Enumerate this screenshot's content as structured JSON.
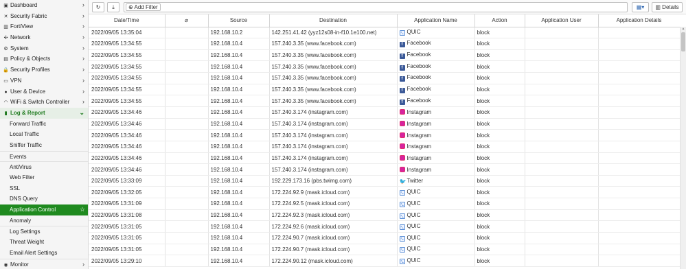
{
  "sidebar": {
    "items": [
      {
        "label": "Dashboard",
        "icon": "dashboard-icon",
        "glyph": "▣",
        "has_chevron": true
      },
      {
        "label": "Security Fabric",
        "icon": "security-fabric-icon",
        "glyph": "✕",
        "has_chevron": true
      },
      {
        "label": "FortiView",
        "icon": "fortiview-icon",
        "glyph": "▥",
        "has_chevron": true
      },
      {
        "label": "Network",
        "icon": "network-icon",
        "glyph": "✣",
        "has_chevron": true
      },
      {
        "label": "System",
        "icon": "gear-icon",
        "glyph": "⚙",
        "has_chevron": true
      },
      {
        "label": "Policy & Objects",
        "icon": "policy-icon",
        "glyph": "▤",
        "has_chevron": true
      },
      {
        "label": "Security Profiles",
        "icon": "lock-icon",
        "glyph": "🔒",
        "has_chevron": true
      },
      {
        "label": "VPN",
        "icon": "vpn-icon",
        "glyph": "▭",
        "has_chevron": true
      },
      {
        "label": "User & Device",
        "icon": "user-icon",
        "glyph": "●",
        "has_chevron": true
      },
      {
        "label": "WiFi & Switch Controller",
        "icon": "wifi-icon",
        "glyph": "◠",
        "has_chevron": true
      }
    ],
    "open_section": {
      "label": "Log & Report",
      "icon": "log-report-icon",
      "glyph": "▮"
    },
    "sub_items": [
      {
        "label": "Forward Traffic",
        "group_top": false,
        "active": false
      },
      {
        "label": "Local Traffic",
        "group_top": false,
        "active": false
      },
      {
        "label": "Sniffer Traffic",
        "group_top": false,
        "active": false
      },
      {
        "label": "Events",
        "group_top": true,
        "active": false
      },
      {
        "label": "AntiVirus",
        "group_top": true,
        "active": false
      },
      {
        "label": "Web Filter",
        "group_top": false,
        "active": false
      },
      {
        "label": "SSL",
        "group_top": false,
        "active": false
      },
      {
        "label": "DNS Query",
        "group_top": false,
        "active": false
      },
      {
        "label": "Application Control",
        "group_top": false,
        "active": true
      },
      {
        "label": "Anomaly",
        "group_top": false,
        "active": false
      },
      {
        "label": "Log Settings",
        "group_top": true,
        "active": false
      },
      {
        "label": "Threat Weight",
        "group_top": false,
        "active": false
      },
      {
        "label": "Email Alert Settings",
        "group_top": false,
        "active": false
      }
    ],
    "bottom_item": {
      "label": "Monitor",
      "icon": "monitor-icon",
      "glyph": "◉"
    }
  },
  "toolbar": {
    "refresh_glyph": "↻",
    "download_glyph": "⤓",
    "add_filter_label": "Add Filter",
    "add_filter_glyph": "⊕",
    "view_glyph": "▦▾",
    "details_label": "Details",
    "details_glyph": "▥"
  },
  "table": {
    "columns": [
      "Date/Time",
      "",
      "Source",
      "Destination",
      "Application Name",
      "Action",
      "Application User",
      "Application Details"
    ],
    "attachment_glyph": "⌀",
    "rows": [
      [
        "2022/09/05 13:35:04",
        "",
        "192.168.10.2",
        "142.251.41.42 (yyz12s08-in-f10.1e100.net)",
        "QUIC",
        "block",
        "",
        ""
      ],
      [
        "2022/09/05 13:34:55",
        "",
        "192.168.10.4",
        "157.240.3.35 (www.facebook.com)",
        "Facebook",
        "block",
        "",
        ""
      ],
      [
        "2022/09/05 13:34:55",
        "",
        "192.168.10.4",
        "157.240.3.35 (www.facebook.com)",
        "Facebook",
        "block",
        "",
        ""
      ],
      [
        "2022/09/05 13:34:55",
        "",
        "192.168.10.4",
        "157.240.3.35 (www.facebook.com)",
        "Facebook",
        "block",
        "",
        ""
      ],
      [
        "2022/09/05 13:34:55",
        "",
        "192.168.10.4",
        "157.240.3.35 (www.facebook.com)",
        "Facebook",
        "block",
        "",
        ""
      ],
      [
        "2022/09/05 13:34:55",
        "",
        "192.168.10.4",
        "157.240.3.35 (www.facebook.com)",
        "Facebook",
        "block",
        "",
        ""
      ],
      [
        "2022/09/05 13:34:55",
        "",
        "192.168.10.4",
        "157.240.3.35 (www.facebook.com)",
        "Facebook",
        "block",
        "",
        ""
      ],
      [
        "2022/09/05 13:34:46",
        "",
        "192.168.10.4",
        "157.240.3.174 (instagram.com)",
        "Instagram",
        "block",
        "",
        ""
      ],
      [
        "2022/09/05 13:34:46",
        "",
        "192.168.10.4",
        "157.240.3.174 (instagram.com)",
        "Instagram",
        "block",
        "",
        ""
      ],
      [
        "2022/09/05 13:34:46",
        "",
        "192.168.10.4",
        "157.240.3.174 (instagram.com)",
        "Instagram",
        "block",
        "",
        ""
      ],
      [
        "2022/09/05 13:34:46",
        "",
        "192.168.10.4",
        "157.240.3.174 (instagram.com)",
        "Instagram",
        "block",
        "",
        ""
      ],
      [
        "2022/09/05 13:34:46",
        "",
        "192.168.10.4",
        "157.240.3.174 (instagram.com)",
        "Instagram",
        "block",
        "",
        ""
      ],
      [
        "2022/09/05 13:34:46",
        "",
        "192.168.10.4",
        "157.240.3.174 (instagram.com)",
        "Instagram",
        "block",
        "",
        ""
      ],
      [
        "2022/09/05 13:33:09",
        "",
        "192.168.10.4",
        "192.229.173.16 (pbs.twimg.com)",
        "Twitter",
        "block",
        "",
        ""
      ],
      [
        "2022/09/05 13:32:05",
        "",
        "192.168.10.4",
        "172.224.92.9 (mask.icloud.com)",
        "QUIC",
        "block",
        "",
        ""
      ],
      [
        "2022/09/05 13:31:09",
        "",
        "192.168.10.4",
        "172.224.92.5 (mask.icloud.com)",
        "QUIC",
        "block",
        "",
        ""
      ],
      [
        "2022/09/05 13:31:08",
        "",
        "192.168.10.4",
        "172.224.92.3 (mask.icloud.com)",
        "QUIC",
        "block",
        "",
        ""
      ],
      [
        "2022/09/05 13:31:05",
        "",
        "192.168.10.4",
        "172.224.92.6 (mask.icloud.com)",
        "QUIC",
        "block",
        "",
        ""
      ],
      [
        "2022/09/05 13:31:05",
        "",
        "192.168.10.4",
        "172.224.90.7 (mask.icloud.com)",
        "QUIC",
        "block",
        "",
        ""
      ],
      [
        "2022/09/05 13:31:05",
        "",
        "192.168.10.4",
        "172.224.90.7 (mask.icloud.com)",
        "QUIC",
        "block",
        "",
        ""
      ],
      [
        "2022/09/05 13:29:10",
        "",
        "192.168.10.4",
        "172.224.90.12 (mask.icloud.com)",
        "QUIC",
        "block",
        "",
        ""
      ]
    ]
  },
  "app_icons": {
    "QUIC": {
      "class": "quic",
      "icon": "quic-icon",
      "glyph": "⤡"
    },
    "Facebook": {
      "class": "facebook",
      "icon": "facebook-icon",
      "glyph": "f"
    },
    "Instagram": {
      "class": "instagram",
      "icon": "instagram-icon",
      "glyph": ""
    },
    "Twitter": {
      "class": "twitter",
      "icon": "twitter-icon",
      "glyph": "🐦"
    }
  },
  "colors": {
    "accent": "#1f8a1f",
    "accent_text": "#1e7a1e"
  }
}
